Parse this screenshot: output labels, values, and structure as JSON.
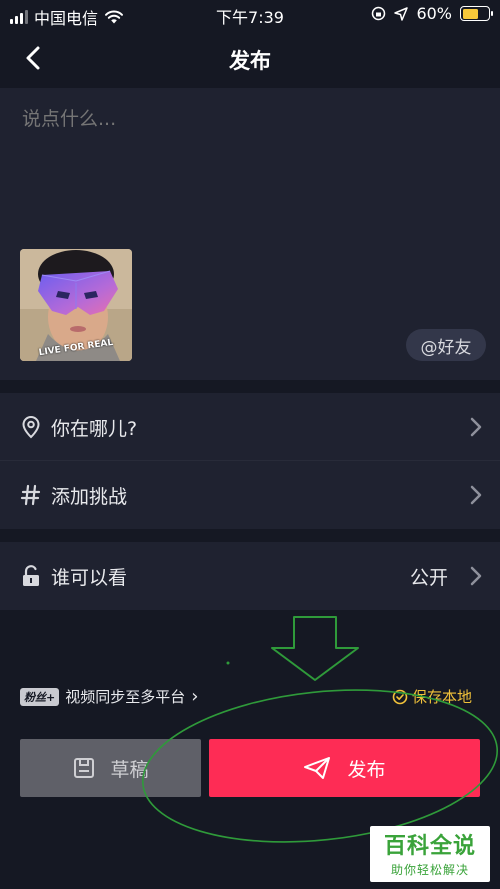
{
  "status_bar": {
    "carrier": "中国电信",
    "time": "下午7:39",
    "battery_percent": "60%",
    "battery_level": 0.6,
    "battery_color": "#f7c83a"
  },
  "nav": {
    "title": "发布",
    "back_icon": "chevron-left-icon"
  },
  "compose": {
    "placeholder": "说点什么...",
    "value": "",
    "cover_caption": "LIVE FOR REAL",
    "mention_button": "@好友"
  },
  "rows": [
    {
      "icon": "location-pin-icon",
      "label": "你在哪儿?",
      "value": ""
    },
    {
      "icon": "hashtag-icon",
      "label": "添加挑战",
      "value": ""
    },
    {
      "icon": "unlock-icon",
      "label": "谁可以看",
      "value": "公开"
    }
  ],
  "sync": {
    "badge": "粉丝+",
    "label": "视频同步至多平台",
    "chevron": "›",
    "save_local": "保存本地",
    "save_local_checked": true
  },
  "actions": {
    "draft_label": "草稿",
    "publish_label": "发布"
  },
  "colors": {
    "background": "#151823",
    "card": "#1f2230",
    "publish": "#fe2c55",
    "draft": "#5f6068",
    "accent_yellow": "#f2c23a",
    "annotation_green": "#2f9a3a"
  },
  "watermark": {
    "title": "百科全说",
    "subtitle": "助你轻松解决"
  }
}
